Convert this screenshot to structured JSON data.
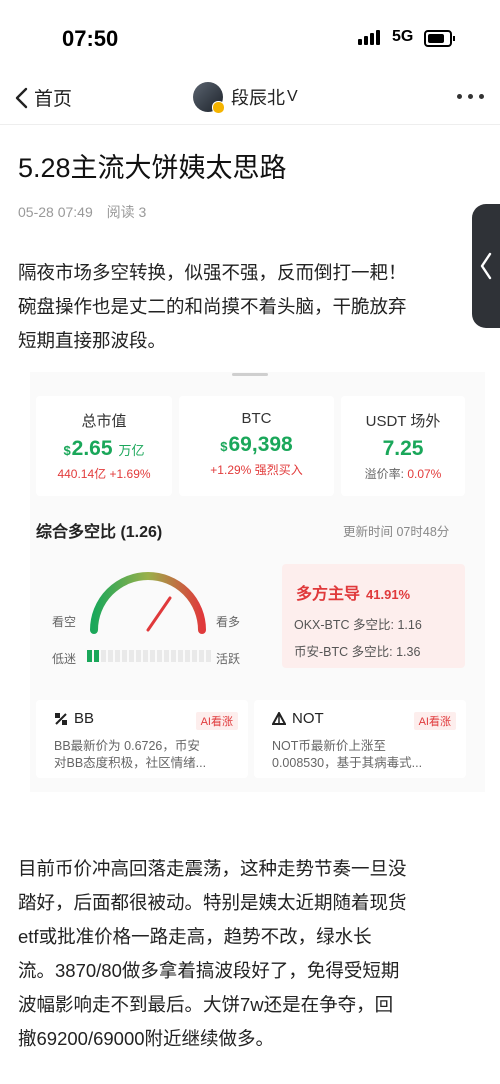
{
  "status": {
    "time": "07:50",
    "network": "5G"
  },
  "nav": {
    "back_label": "首页",
    "author_name": "段辰北",
    "author_badge": "V"
  },
  "article": {
    "title": "5.28主流大饼姨太思路",
    "date": "05-28 07:49",
    "reads": "阅读 3",
    "intro_lines": [
      "隔夜市场多空转换，似强不强，反而倒打一耙！",
      "碗盘操作也是丈二的和尚摸不着头脑，干脆放弃",
      "短期直接那波段。"
    ],
    "body_lines": [
      "目前币价冲高回落走震荡，这种走势节奏一旦没",
      "踏好，后面都很被动。特别是姨太近期随着现货",
      "etf或批准价格一路走高，趋势不改，绿水长",
      "流。3870/80做多拿着搞波段好了，免得受短期",
      "波幅影响走不到最后。大饼7w还是在争夺，回",
      "撤69200/69000附近继续做多。"
    ]
  },
  "market": {
    "cards": [
      {
        "label": "总市值",
        "currency": "$",
        "value": "2.65",
        "unit": "万亿",
        "sub_a": "440.14亿",
        "sub_b": "+1.69%"
      },
      {
        "label": "BTC",
        "currency": "$",
        "value": "69,398",
        "unit": "",
        "sub_a": "+1.29%",
        "sub_b": "强烈买入"
      },
      {
        "label": "USDT 场外",
        "currency": "",
        "value": "7.25",
        "unit": "",
        "sub_a": "溢价率:",
        "sub_b": "0.07%"
      }
    ],
    "ratio": {
      "title": "综合多空比 (1.26)",
      "updated": "更新时间 07时48分",
      "gauge_left": "看空",
      "gauge_right": "看多",
      "activity_low": "低迷",
      "activity_high": "活跃",
      "activity_level": 0.1,
      "bull_title": "多方主导",
      "bull_pct": "41.91%",
      "okx_line": "OKX-BTC 多空比: 1.16",
      "binance_line": "币安-BTC 多空比: 1.36"
    },
    "coins": [
      {
        "name": "BB",
        "tag": "AI看涨",
        "desc_1": "BB最新价为 0.6726，币安",
        "desc_2": "对BB态度积极，社区情绪..."
      },
      {
        "name": "NOT",
        "tag": "AI看涨",
        "desc_1": "NOT币最新价上涨至",
        "desc_2": "0.008530，基于其病毒式..."
      }
    ]
  },
  "colors": {
    "green": "#1aa75a",
    "red": "#e0393b",
    "accent_bg": "#fdeeed"
  }
}
